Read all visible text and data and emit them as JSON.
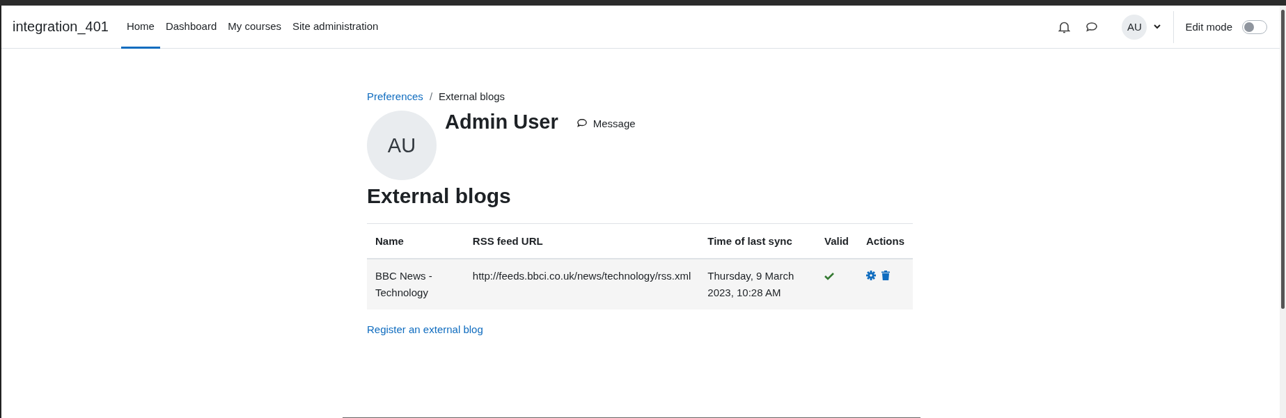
{
  "navbar": {
    "brand": "integration_401",
    "items": [
      {
        "label": "Home",
        "selected": true
      },
      {
        "label": "Dashboard",
        "selected": false
      },
      {
        "label": "My courses",
        "selected": false
      },
      {
        "label": "Site administration",
        "selected": false
      }
    ],
    "user_initials": "AU",
    "edit_mode": {
      "label": "Edit mode",
      "on": false
    }
  },
  "breadcrumb_separator": "/",
  "breadcrumb": [
    {
      "label": "Preferences",
      "link": true
    },
    {
      "label": "External blogs",
      "link": false
    }
  ],
  "profile": {
    "initials": "AU",
    "name": "Admin User",
    "message": "Message"
  },
  "heading": "External blogs",
  "table": {
    "columns": [
      "Name",
      "RSS feed URL",
      "Time of last sync",
      "Valid",
      "Actions"
    ],
    "rows": [
      {
        "name": "BBC News - Technology",
        "url": "http://feeds.bbci.co.uk/news/technology/rss.xml",
        "last_sync": "Thursday, 9 March 2023, 10:28 AM",
        "valid": true
      }
    ]
  },
  "register_link": "Register an external blog"
}
